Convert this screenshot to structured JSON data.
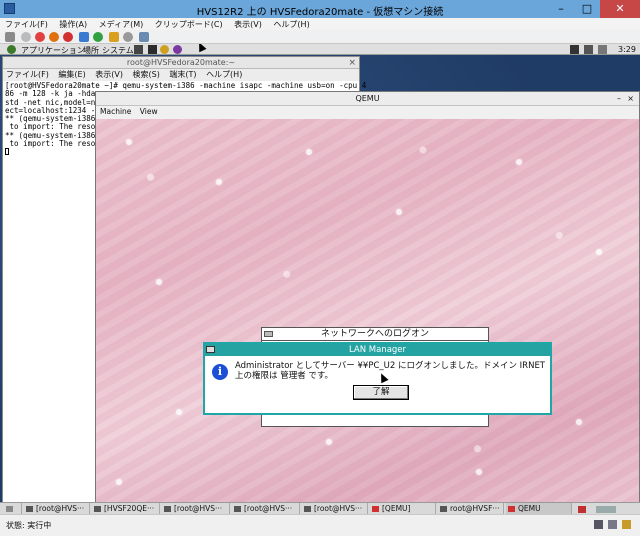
{
  "host": {
    "title": "HVS12R2 上の HVSFedora20mate - 仮想マシン接続",
    "window_buttons": [
      "–",
      "□",
      "✕"
    ],
    "menu": [
      "ファイル(F)",
      "操作(A)",
      "メディア(M)",
      "クリップボード(C)",
      "表示(V)",
      "ヘルプ(H)"
    ],
    "status": "状態: 実行中"
  },
  "mate_panel": {
    "items": [
      "アプリケーション",
      "場所",
      "システム"
    ],
    "clock": "3:29"
  },
  "terminal": {
    "title": "root@HVSFedora20mate:~",
    "menu": [
      "ファイル(F)",
      "編集(E)",
      "表示(V)",
      "検索(S)",
      "端末(T)",
      "ヘルプ(H)"
    ],
    "lines": [
      "[root@HVSFedora20mate ~]# qemu-system-i386 -machine isapc -machine usb=on -cpu 4",
      "86 -m 128 -k ja -hda",
      "std -net nic,model=ne",
      "ect=localhost:1234 -l",
      "",
      "** (qemu-system-i386:",
      " to import: The resou",
      "",
      "** (qemu-system-i386:",
      " to import: The resou"
    ]
  },
  "qemu": {
    "title": "QEMU",
    "menu": [
      "Machine",
      "View"
    ]
  },
  "logon_window": {
    "title": "ネットワークへのログオン"
  },
  "lan_manager": {
    "title": "LAN Manager",
    "message_line1": "Administrator としてサーバー ¥¥PC_U2 にログオンしました。ドメイン  IRNET",
    "message_line2": "上の権限は 管理者 です。",
    "ok_label": "了解"
  },
  "taskbar": {
    "tasks": [
      "[root@HVS···",
      "[HVSF20QE···",
      "[root@HVS···",
      "[root@HVS···",
      "[root@HVS···",
      "[QEMU]",
      "root@HVSF···",
      "QEMU"
    ]
  }
}
